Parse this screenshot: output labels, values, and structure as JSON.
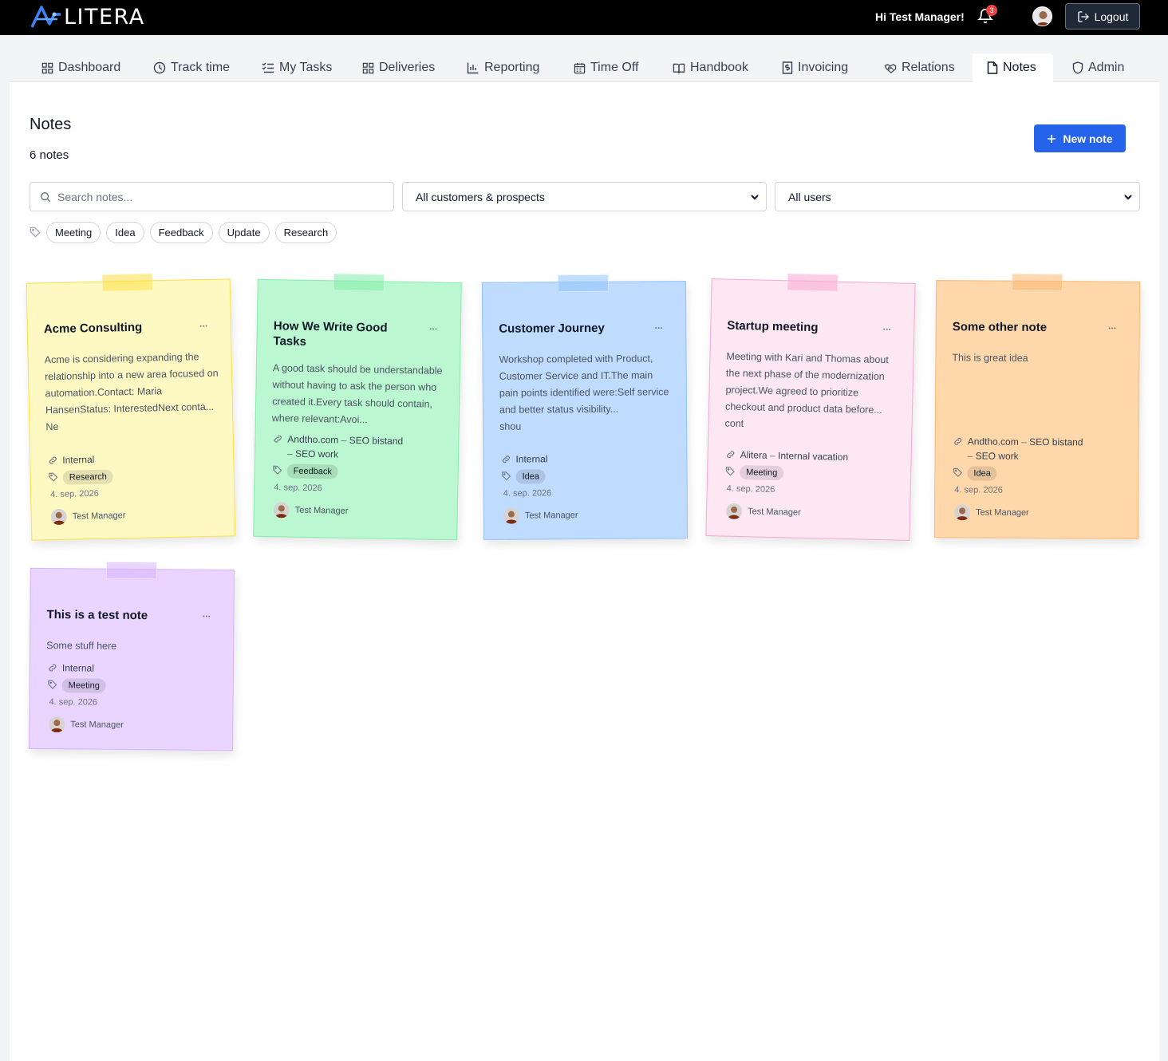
{
  "header": {
    "logo_text": "LITERA",
    "greeting": "Hi Test Manager!",
    "notification_count": "3",
    "logout_label": "Logout"
  },
  "tabs": [
    {
      "label": "Dashboard",
      "icon": "grid-icon"
    },
    {
      "label": "Track time",
      "icon": "clock-icon"
    },
    {
      "label": "My Tasks",
      "icon": "checklist-icon"
    },
    {
      "label": "Deliveries",
      "icon": "grid-icon"
    },
    {
      "label": "Reporting",
      "icon": "bar-chart-icon"
    },
    {
      "label": "Time Off",
      "icon": "calendar-icon"
    },
    {
      "label": "Handbook",
      "icon": "book-icon"
    },
    {
      "label": "Invoicing",
      "icon": "receipt-icon"
    },
    {
      "label": "Relations",
      "icon": "handshake-icon"
    },
    {
      "label": "Notes",
      "icon": "file-icon",
      "active": true
    },
    {
      "label": "Admin",
      "icon": "shield-icon"
    }
  ],
  "page": {
    "title": "Notes",
    "count": "6 notes",
    "new_note_label": "New note",
    "search_placeholder": "Search notes...",
    "customer_filter": "All customers & prospects",
    "user_filter": "All users",
    "tags": [
      "Meeting",
      "Idea",
      "Feedback",
      "Update",
      "Research"
    ]
  },
  "notes": [
    {
      "title": "Acme Consulting",
      "body": "Acme is considering expanding the relationship into a new area focused on automation.Contact: Maria HansenStatus: InterestedNext conta...",
      "body_tail": "Ne",
      "link": "Internal",
      "link_sub": "",
      "tag": "Research",
      "date": "4. sep. 2026",
      "author": "Test Manager",
      "color": "#fef9c3",
      "border": "#fde047"
    },
    {
      "title": "How We Write Good Tasks",
      "body": "A good task should be understandable without having to ask the person who created it.Every task should contain, where relevant:Avoi...",
      "body_tail": "",
      "link": "Andtho.com",
      "link_sub": "SEO bistand",
      "link_sub2": "SEO work",
      "tag": "Feedback",
      "date": "4. sep. 2026",
      "author": "Test Manager",
      "color": "#bbf7d0",
      "border": "#86efac"
    },
    {
      "title": "Customer Journey",
      "body": "Workshop completed with Product, Customer Service and IT.The main pain points identified were:Self service and better status visibility...",
      "body_tail": "shou",
      "link": "Internal",
      "link_sub": "",
      "tag": "Idea",
      "date": "4. sep. 2026",
      "author": "Test Manager",
      "color": "#bfdbfe",
      "border": "#93c5fd"
    },
    {
      "title": "Startup meeting",
      "body": "Meeting with Kari and Thomas about the next phase of the modernization project.We agreed to prioritize checkout and product data before...",
      "body_tail": "cont",
      "link": "Alitera",
      "link_sub": "Internal vacation",
      "tag": "Meeting",
      "date": "4. sep. 2026",
      "author": "Test Manager",
      "color": "#fce7f3",
      "border": "#f9a8d4"
    },
    {
      "title": "Some other note",
      "body": "This is great idea",
      "body_tail": "",
      "link": "Andtho.com",
      "link_sub": "SEO bistand",
      "link_sub2": "SEO work",
      "tag": "Idea",
      "date": "4. sep. 2026",
      "author": "Test Manager",
      "color": "#fed7aa",
      "border": "#fdba74"
    },
    {
      "title": "This is a test note",
      "body": "Some stuff here",
      "body_tail": "",
      "link": "Internal",
      "link_sub": "",
      "tag": "Meeting",
      "date": "4. sep. 2026",
      "author": "Test Manager",
      "color": "#e9d5ff",
      "border": "#d8b4fe"
    }
  ],
  "colors": {
    "primary": "#2563eb",
    "topbar": "#000000",
    "badge": "#ef4444"
  }
}
